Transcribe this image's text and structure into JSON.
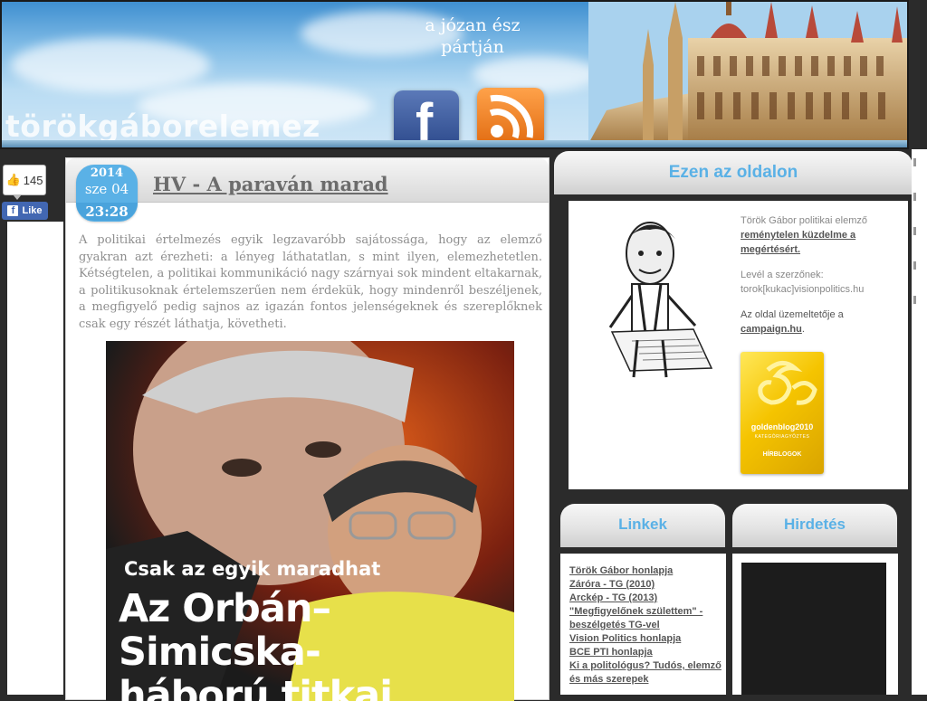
{
  "header": {
    "site_title": "törökgáborelemez",
    "slogan_line1": "a józan ész",
    "slogan_line2": "pártján"
  },
  "like_widget": {
    "count": "145",
    "button_label": "Like"
  },
  "post": {
    "date_year": "2014",
    "date_day": "sze 04",
    "date_time": "23:28",
    "title": "HV - A paraván marad",
    "body": "A politikai értelmezés egyik legzavaróbb sajátossága, hogy az elemző gyakran azt érezheti: a lényeg láthatatlan, s mint ilyen, elemezhetetlen. Kétségtelen, a politikai kommunikáció nagy szárnyai sok mindent eltakarnak, a politikusoknak értelemszerűen nem érdekük, hogy mindenről beszéljenek, a megfigyelő pedig sajnos az igazán fontos jelenségeknek és szereplőknek csak egy részét láthatja, követheti.",
    "image_caption_small": "Csak az egyik maradhat",
    "image_caption_big_1": "Az Orbán–",
    "image_caption_big_2": "Simicska-",
    "image_caption_big_3": "háború titkai"
  },
  "sidebar": {
    "about_title": "Ezen az oldalon",
    "about_text_prefix": "Török Gábor politikai elemző",
    "about_link": "reménytelen küzdelme a megértésért.",
    "contact_label": "Levél a szerzőnek:",
    "contact_email": "torok[kukac]visionpolitics.hu",
    "operator_prefix": "Az oldal üzemeltetője a",
    "operator_link": "campaign.hu",
    "operator_suffix": ".",
    "award_name": "goldenblog2010",
    "award_category": "KATEGÓRIAGYŐZTES",
    "award_sub": "HÍRBLOGOK",
    "links_title": "Linkek",
    "ads_title": "Hirdetés",
    "links": [
      "Török Gábor honlapja",
      "Záróra - TG (2010)",
      "Arckép - TG (2013)",
      "\"Megfigyelőnek születtem\" - beszélgetés TG-vel",
      "Vision Politics honlapja",
      "BCE PTI honlapja",
      "Ki a politológus? Tudós, elemző és más szerepek"
    ]
  },
  "colors": {
    "accent": "#5ab1e6",
    "background": "#2b2b2b",
    "facebook": "#4267b2"
  }
}
